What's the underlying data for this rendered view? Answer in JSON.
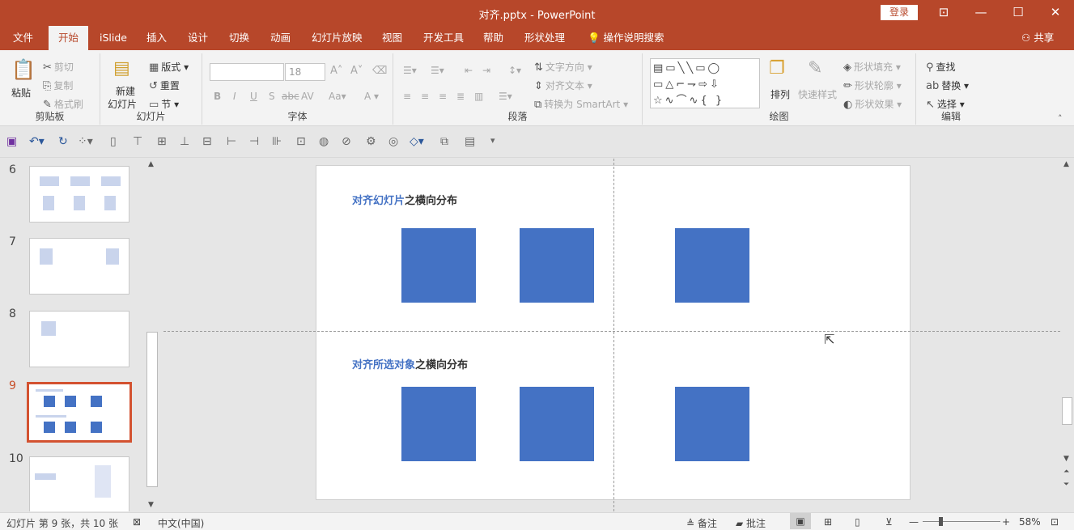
{
  "window": {
    "title": "对齐.pptx  -  PowerPoint",
    "login": "登录"
  },
  "tabs": [
    "文件",
    "开始",
    "iSlide",
    "插入",
    "设计",
    "切换",
    "动画",
    "幻灯片放映",
    "视图",
    "开发工具",
    "帮助",
    "形状处理"
  ],
  "tell_me": "操作说明搜索",
  "share": "共享",
  "ribbon": {
    "clipboard": {
      "label": "剪贴板",
      "paste": "粘贴",
      "cut": "剪切",
      "copy": "复制",
      "painter": "格式刷"
    },
    "slides": {
      "label": "幻灯片",
      "new1": "新建",
      "new2": "幻灯片",
      "layout": "版式",
      "reset": "重置",
      "section": "节"
    },
    "font": {
      "label": "字体",
      "font_name": "",
      "font_size": "18"
    },
    "paragraph": {
      "label": "段落",
      "text_dir": "文字方向",
      "align_text": "对齐文本",
      "smartart": "转换为 SmartArt"
    },
    "drawing": {
      "label": "绘图",
      "arrange": "排列",
      "quick_styles": "快速样式",
      "fill": "形状填充",
      "outline": "形状轮廓",
      "effects": "形状效果"
    },
    "editing": {
      "label": "编辑",
      "find": "查找",
      "replace": "替换",
      "select": "选择"
    }
  },
  "thumbnails": [
    {
      "num": "6"
    },
    {
      "num": "7"
    },
    {
      "num": "8"
    },
    {
      "num": "9",
      "selected": true
    },
    {
      "num": "10"
    }
  ],
  "slide": {
    "section1": {
      "highlight": "对齐幻灯片",
      "rest": "之横向分布"
    },
    "section2": {
      "highlight": "对齐所选对象",
      "rest": "之横向分布"
    }
  },
  "status": {
    "slide_info": "幻灯片 第 9 张，共 10 张",
    "language": "中文(中国)",
    "notes": "备注",
    "comments": "批注",
    "zoom": "58%"
  },
  "colors": {
    "brand": "#b7472a",
    "shape": "#4472c4",
    "selection": "#d35230"
  }
}
